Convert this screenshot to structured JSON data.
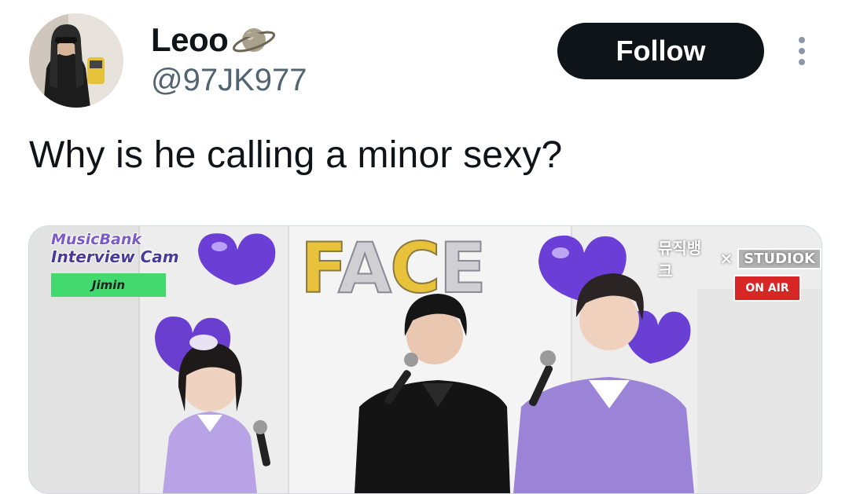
{
  "tweet": {
    "display_name": "Leoo",
    "handle": "@97JK977",
    "follow_label": "Follow",
    "text": "Why is he calling a minor sexy?"
  },
  "media": {
    "overlay": {
      "show_line1": "MusicBank",
      "show_line2": "Interview Cam",
      "name": "Jimin"
    },
    "balloon_letters": [
      "F",
      "A",
      "C",
      "E"
    ],
    "studio_logo": {
      "korean": "뮤직뱅크",
      "cross": "×",
      "studio": "STUDIO",
      "k": "K"
    },
    "on_air": "ON AIR"
  },
  "colors": {
    "follow_bg": "#0f1419",
    "handle": "#536471",
    "text": "#0f1419"
  }
}
